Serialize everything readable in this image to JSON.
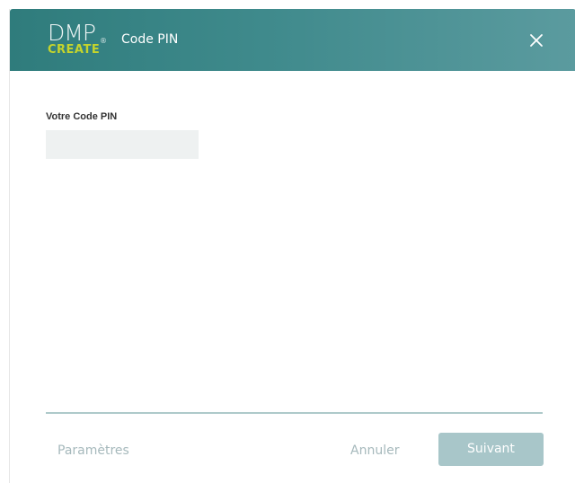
{
  "header": {
    "logo_top": "DMP",
    "logo_reg": "®",
    "logo_bottom": "CREATE",
    "title": "Code PIN",
    "close_icon": "close-icon"
  },
  "form": {
    "pin_label": "Votre Code PIN",
    "pin_value": "",
    "pin_placeholder": ""
  },
  "footer": {
    "settings_label": "Paramètres",
    "cancel_label": "Annuler",
    "next_label": "Suivant"
  },
  "colors": {
    "header_start": "#2f7c7c",
    "header_end": "#5b9b9f",
    "logo_accent": "#c4d42c",
    "next_button": "#a8c6c9",
    "divider": "#aec9ca",
    "muted_text": "#a6b9bc",
    "input_bg": "#eef1f1"
  }
}
